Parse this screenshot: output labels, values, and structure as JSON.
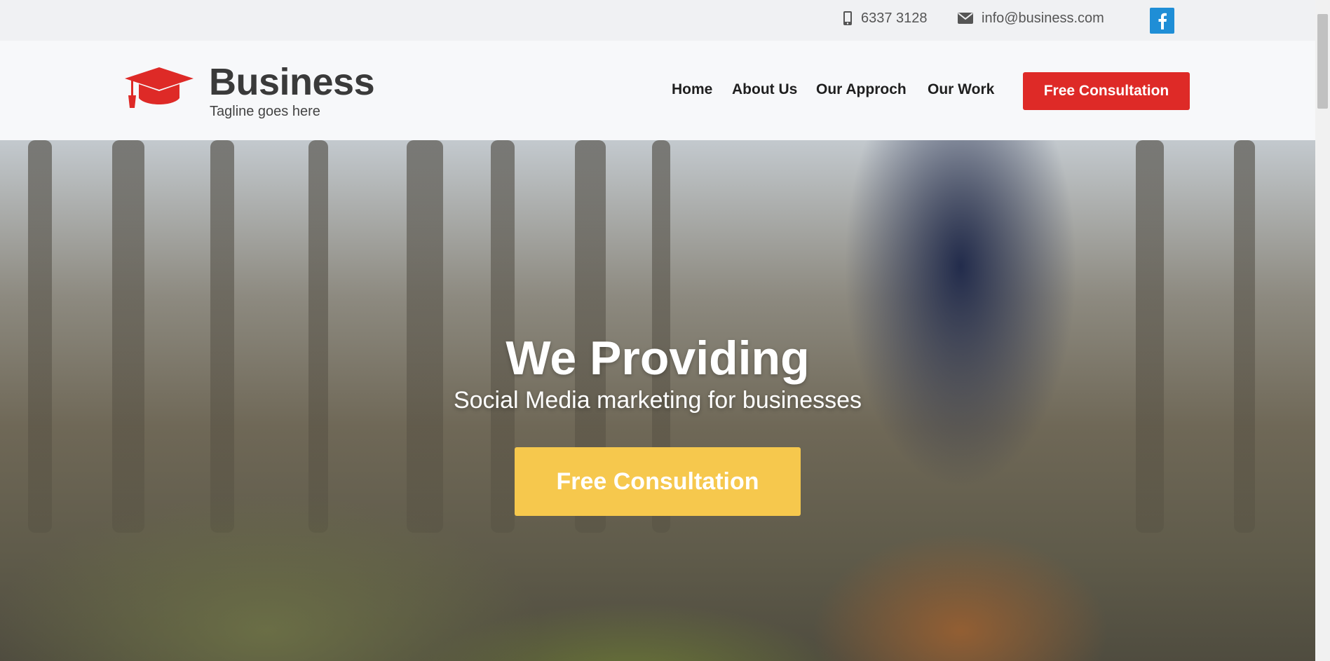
{
  "topbar": {
    "phone": "6337 3128",
    "email": "info@business.com",
    "social_icon": "facebook-icon"
  },
  "header": {
    "brand": "Business",
    "tagline": "Tagline goes here",
    "logo_icon": "graduation-cap-icon",
    "nav": [
      "Home",
      "About Us",
      "Our Approch",
      "Our Work"
    ],
    "cta": "Free Consultation"
  },
  "hero": {
    "title": "We Providing",
    "subtitle": "Social Media marketing for businesses",
    "cta": "Free Consultation"
  },
  "colors": {
    "accent_red": "#de2a27",
    "accent_yellow": "#f6c84d",
    "facebook_blue": "#1f8ed6"
  }
}
